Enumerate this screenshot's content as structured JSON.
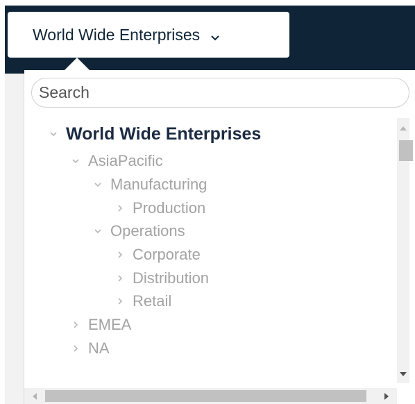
{
  "header": {
    "org_selector_label": "World Wide Enterprises",
    "chevron_icon": "chevron-down-icon",
    "background_color": "#0f2537"
  },
  "search": {
    "placeholder": "Search",
    "value": ""
  },
  "tree": {
    "root": {
      "label": "World Wide Enterprises",
      "expanded": true
    },
    "nodes": [
      {
        "label": "AsiaPacific",
        "level": 1,
        "expanded": true
      },
      {
        "label": "Manufacturing",
        "level": 2,
        "expanded": true
      },
      {
        "label": "Production",
        "level": 3,
        "expanded": false
      },
      {
        "label": "Operations",
        "level": 2,
        "expanded": true
      },
      {
        "label": "Corporate",
        "level": 3,
        "expanded": false
      },
      {
        "label": "Distribution",
        "level": 3,
        "expanded": false
      },
      {
        "label": "Retail",
        "level": 3,
        "expanded": false
      },
      {
        "label": "EMEA",
        "level": 1,
        "expanded": false
      },
      {
        "label": "NA",
        "level": 1,
        "expanded": false
      }
    ]
  },
  "colors": {
    "root_text": "#1b2b42",
    "node_text": "#a3a3a3",
    "chevron": "#b8b8b8"
  }
}
